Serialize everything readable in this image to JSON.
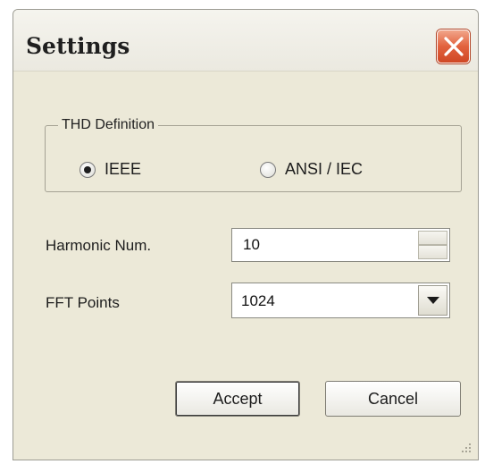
{
  "window": {
    "title": "Settings"
  },
  "thd_group": {
    "legend": "THD Definition",
    "options": [
      {
        "label": "IEEE",
        "selected": true
      },
      {
        "label": "ANSI / IEC",
        "selected": false
      }
    ]
  },
  "fields": {
    "harmonic_label": "Harmonic Num.",
    "harmonic_value": "10",
    "fft_label": "FFT Points",
    "fft_value": "1024"
  },
  "buttons": {
    "accept": "Accept",
    "cancel": "Cancel"
  },
  "colors": {
    "dialog_bg": "#ece9d8",
    "close_button": "#e2623e"
  },
  "icons": {
    "close": "close-icon",
    "spinner": "spinner-arrows-icon",
    "dropdown": "chevron-down-icon",
    "resize": "resize-grip-icon"
  }
}
